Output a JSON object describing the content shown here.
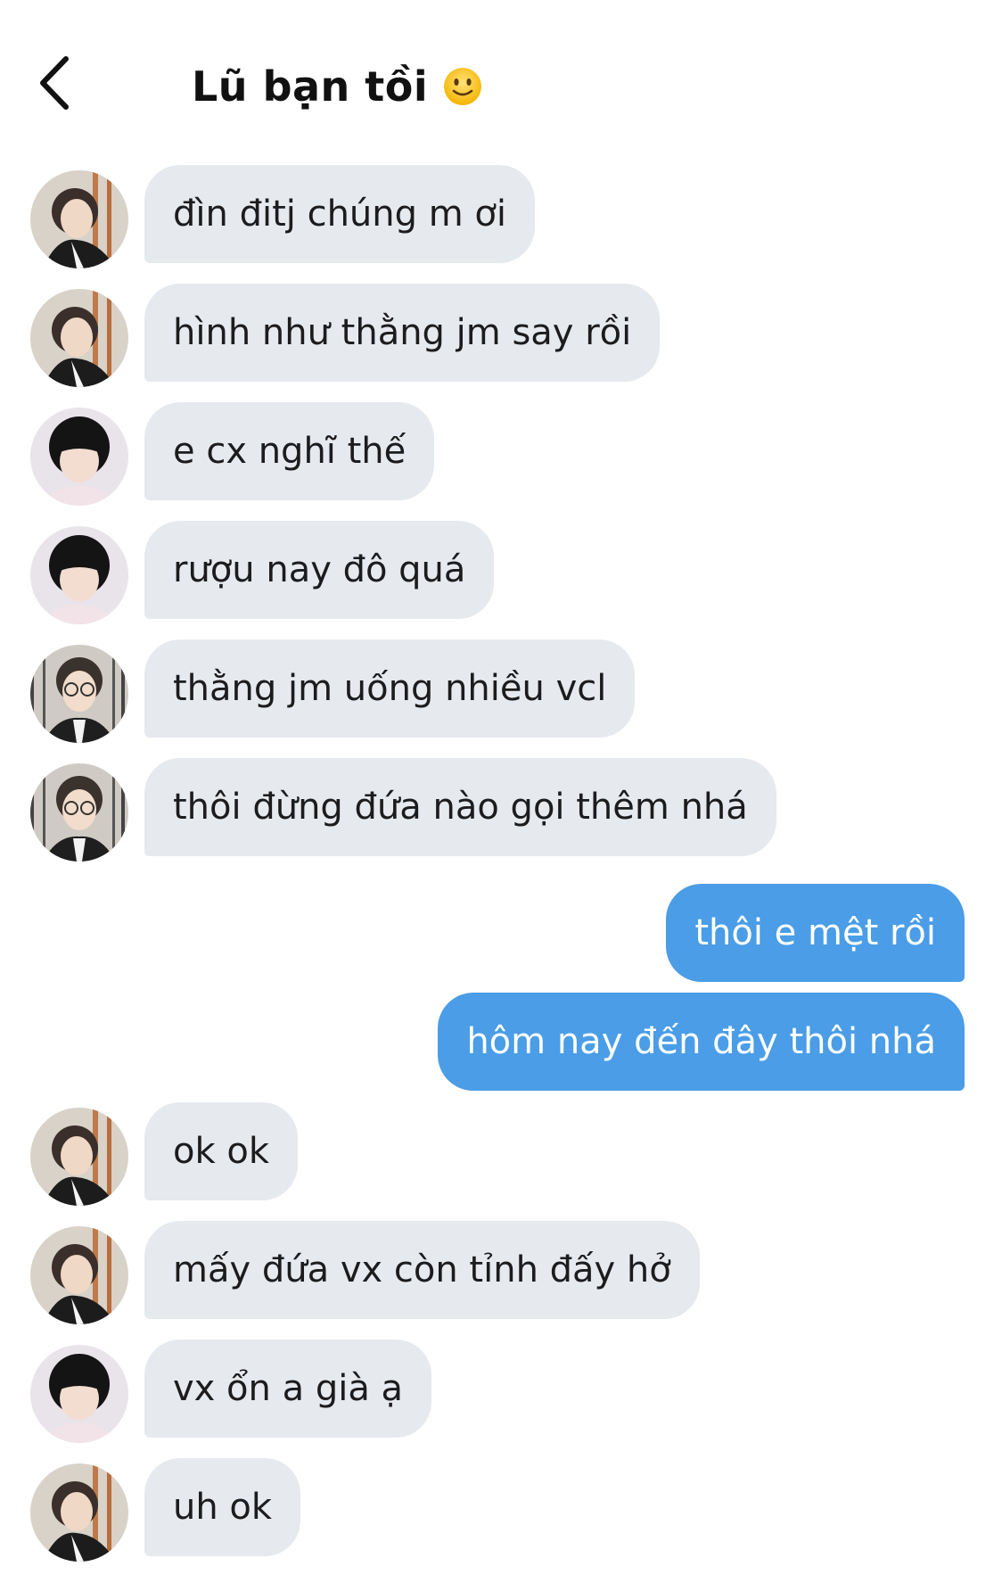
{
  "header": {
    "back_icon": "chevron-left-icon",
    "title": "Lũ bạn tồi",
    "title_emoji_icon": "slightly-smiling-face-icon"
  },
  "messages": [
    {
      "sender": "in",
      "avatar": "avatar-a",
      "text": "đìn đitj chúng m ơi"
    },
    {
      "sender": "in",
      "avatar": "avatar-a",
      "text": "hình như thằng jm say rồi"
    },
    {
      "sender": "in",
      "avatar": "avatar-b",
      "text": "e cx nghĩ thế"
    },
    {
      "sender": "in",
      "avatar": "avatar-b",
      "text": "rượu nay đô quá"
    },
    {
      "sender": "in",
      "avatar": "avatar-c",
      "text": "thằng jm uống nhiều vcl"
    },
    {
      "sender": "in",
      "avatar": "avatar-c",
      "text": "thôi đừng đứa nào gọi thêm nhá"
    },
    {
      "sender": "out",
      "text": "thôi e mệt rồi"
    },
    {
      "sender": "out",
      "text": "hôm nay đến đây thôi nhá"
    },
    {
      "sender": "in",
      "avatar": "avatar-a",
      "text": "ok ok"
    },
    {
      "sender": "in",
      "avatar": "avatar-a",
      "text": "mấy đứa vx còn tỉnh đấy hở"
    },
    {
      "sender": "in",
      "avatar": "avatar-b",
      "text": "vx ổn a già ạ"
    },
    {
      "sender": "in",
      "avatar": "avatar-a",
      "text": "uh ok"
    }
  ],
  "colors": {
    "incoming_bubble": "#e6e9ee",
    "outgoing_bubble": "#4a9de6",
    "outgoing_text": "#ffffff",
    "incoming_text": "#1c1c1e"
  }
}
